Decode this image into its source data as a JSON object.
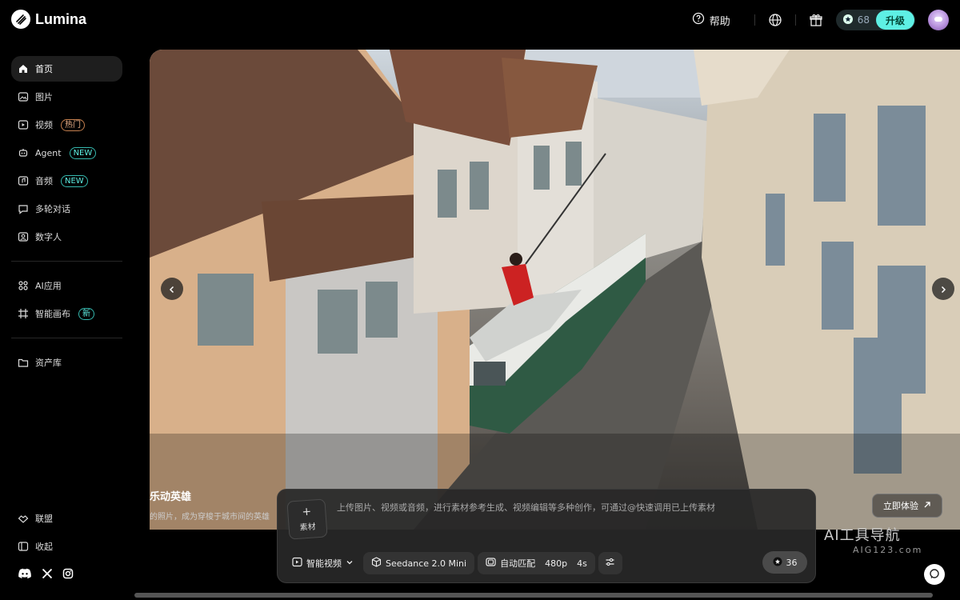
{
  "app": {
    "name": "Lumina"
  },
  "header": {
    "help_label": "帮助",
    "credits": "68",
    "upgrade_label": "升级"
  },
  "sidebar": {
    "items": [
      {
        "label": "首页",
        "icon": "home-icon"
      },
      {
        "label": "图片",
        "icon": "image-icon"
      },
      {
        "label": "视频",
        "icon": "video-icon",
        "badge": "热门"
      },
      {
        "label": "Agent",
        "icon": "agent-icon",
        "badge": "NEW"
      },
      {
        "label": "音频",
        "icon": "audio-icon",
        "badge": "NEW"
      },
      {
        "label": "多轮对话",
        "icon": "chat-icon"
      },
      {
        "label": "数字人",
        "icon": "avatar-icon"
      },
      {
        "label": "AI应用",
        "icon": "apps-icon"
      },
      {
        "label": "智能画布",
        "icon": "canvas-icon",
        "badge": "新"
      },
      {
        "label": "资产库",
        "icon": "folder-icon"
      }
    ],
    "bottom": [
      {
        "label": "联盟",
        "icon": "alliance-icon"
      },
      {
        "label": "收起",
        "icon": "collapse-icon"
      }
    ],
    "socials": [
      "discord-icon",
      "x-icon",
      "instagram-icon"
    ]
  },
  "hero": {
    "title": "乐动英雄",
    "subtitle": "的照片，成为穿梭于城市间的英雄",
    "cta_label": "立即体验"
  },
  "composer": {
    "upload_plus": "+",
    "upload_label": "素材",
    "prompt": "上传图片、视频或音频，进行素材参考生成、视频编辑等多种创作，可通过@快速调用已上传素材",
    "mode_label": "智能视频",
    "model_label": "Seedance 2.0 Mini",
    "ratio_label": "自动匹配",
    "resolution": "480p",
    "duration": "4s",
    "cost": "36"
  },
  "watermark": {
    "line1": "AI工具导航",
    "line2": "AIG123.com"
  },
  "colors": {
    "accent": "#5ef0e4",
    "hot": "#f1b48a",
    "background": "#000000"
  }
}
